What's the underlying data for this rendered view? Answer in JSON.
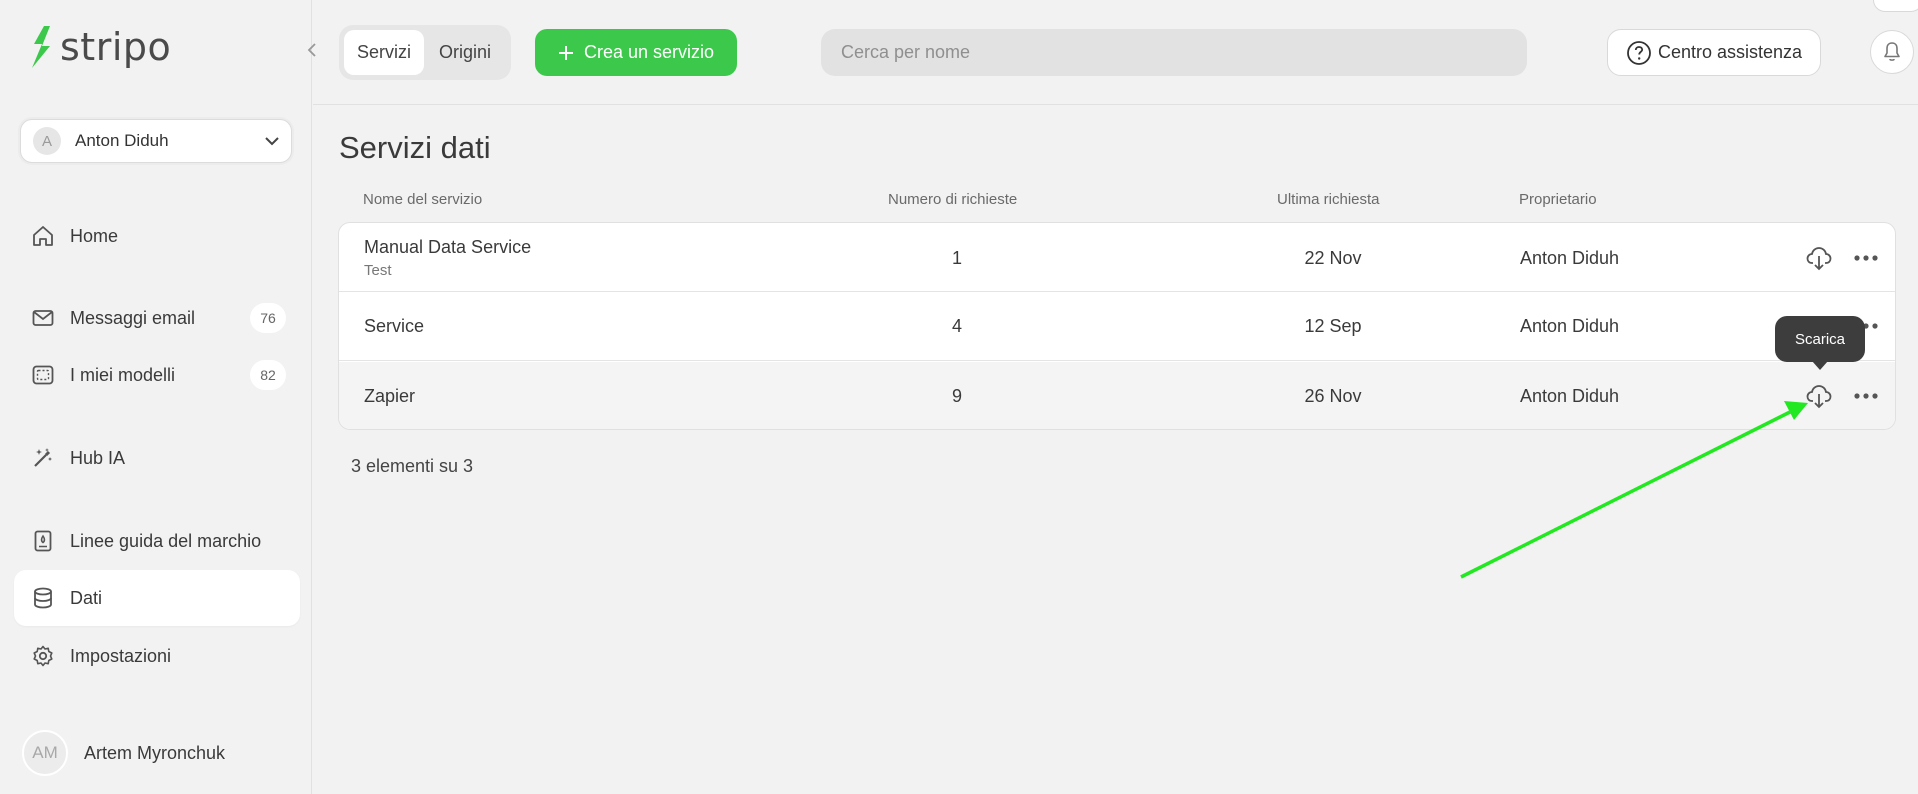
{
  "brand": {
    "name": "stripo",
    "accent": "#3cc94b"
  },
  "account": {
    "initial": "A",
    "name": "Anton Diduh"
  },
  "sidebar": {
    "items": [
      {
        "label": "Home",
        "icon": "home-icon"
      },
      {
        "label": "Messaggi email",
        "icon": "mail-icon",
        "badge": "76"
      },
      {
        "label": "I miei modelli",
        "icon": "template-icon",
        "badge": "82"
      },
      {
        "label": "Hub IA",
        "icon": "magic-wand-icon"
      },
      {
        "label": "Linee guida del marchio",
        "icon": "brand-book-icon"
      },
      {
        "label": "Dati",
        "icon": "database-icon",
        "active": true
      },
      {
        "label": "Impostazioni",
        "icon": "gear-icon"
      }
    ]
  },
  "user": {
    "initials": "AM",
    "name": "Artem Myronchuk"
  },
  "toolbar": {
    "tabs": [
      "Servizi",
      "Origini"
    ],
    "create_label": "Crea un servizio",
    "search_placeholder": "Cerca per nome",
    "help_label": "Centro assistenza"
  },
  "main": {
    "title": "Servizi dati",
    "columns": [
      "Nome del servizio",
      "Numero di richieste",
      "Ultima richiesta",
      "Proprietario"
    ],
    "rows": [
      {
        "name": "Manual Data Service",
        "sub": "Test",
        "requests": "1",
        "last": "22 Nov",
        "owner": "Anton Diduh"
      },
      {
        "name": "Service",
        "sub": "",
        "requests": "4",
        "last": "12 Sep",
        "owner": "Anton Diduh"
      },
      {
        "name": "Zapier",
        "sub": "",
        "requests": "9",
        "last": "26 Nov",
        "owner": "Anton Diduh"
      }
    ],
    "count_text": "3 elementi su 3",
    "tooltip": "Scarica"
  },
  "annotation": {
    "color": "#22e822"
  }
}
